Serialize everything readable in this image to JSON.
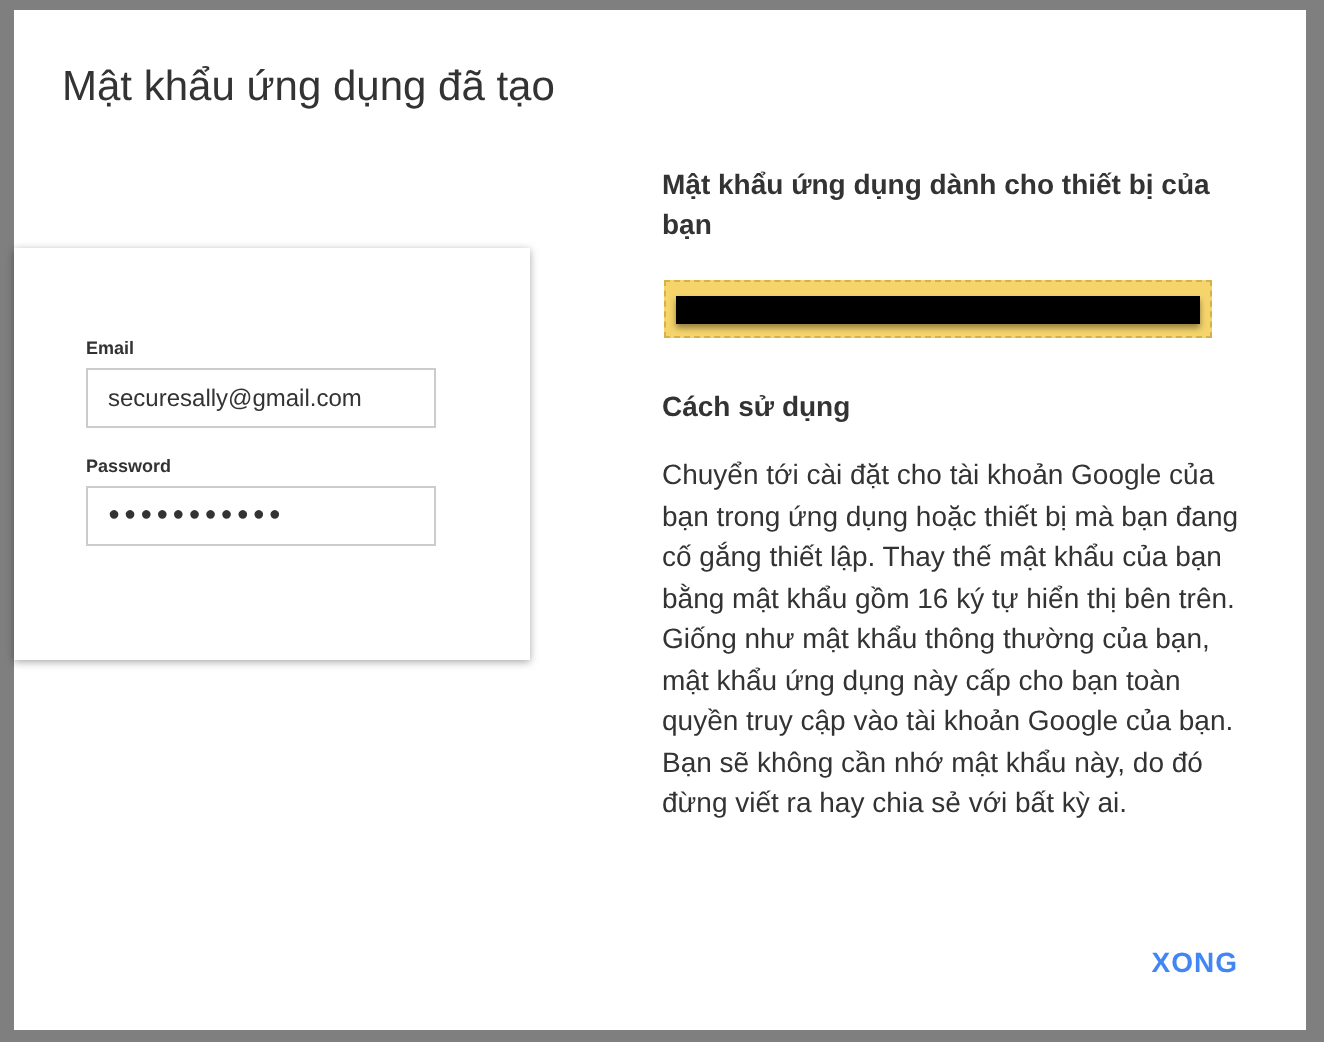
{
  "dialog": {
    "title": "Mật khẩu ứng dụng đã tạo"
  },
  "illustration": {
    "email_label": "Email",
    "email_value": "securesally@gmail.com",
    "password_label": "Password",
    "password_value": "●●●●●●●●●●●"
  },
  "password_section": {
    "heading": "Mật khẩu ứng dụng dành cho thiết bị của bạn",
    "redacted": true
  },
  "usage": {
    "heading": "Cách sử dụng",
    "paragraphs": [
      "Chuyển tới cài đặt cho tài khoản Google của bạn trong ứng dụng hoặc thiết bị mà bạn đang cố gắng thiết lập. Thay thế mật khẩu của bạn bằng mật khẩu gồm 16 ký tự hiển thị bên trên.",
      "Giống như mật khẩu thông thường của bạn, mật khẩu ứng dụng này cấp cho bạn toàn quyền truy cập vào tài khoản Google của bạn. Bạn sẽ không cần nhớ mật khẩu này, do đó đừng viết ra hay chia sẻ với bất kỳ ai."
    ]
  },
  "buttons": [
    {
      "label": "XONG"
    }
  ]
}
